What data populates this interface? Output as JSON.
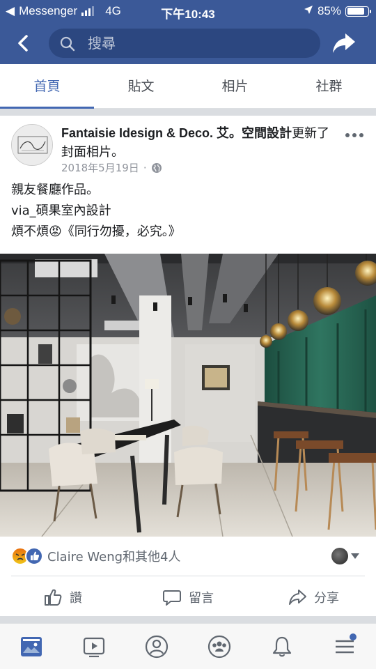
{
  "status_bar": {
    "carrier": "Messenger",
    "network": "4G",
    "time": "下午10:43",
    "battery_percent": "85%",
    "battery_level": 0.85
  },
  "top_nav": {
    "search_placeholder": "搜尋"
  },
  "tabs": [
    {
      "label": "首頁",
      "active": true
    },
    {
      "label": "貼文",
      "active": false
    },
    {
      "label": "相片",
      "active": false
    },
    {
      "label": "社群",
      "active": false
    }
  ],
  "post": {
    "author": "Fantaisie Idesign & Deco. 艾。空間設計",
    "action": "更新了封面相片。",
    "date": "2018年5月19日",
    "privacy_icon": "globe-icon",
    "caption": [
      "親友餐廳作品。",
      "via_碩果室內設計",
      "煩不煩😡《同行勿擾，必究。》"
    ],
    "reactions": {
      "icons": [
        "angry-reaction-icon",
        "like-reaction-icon"
      ],
      "text": "Claire Weng和其他4人"
    },
    "actions": [
      {
        "label": "讚",
        "icon": "thumbs-up-icon"
      },
      {
        "label": "留言",
        "icon": "comment-icon"
      },
      {
        "label": "分享",
        "icon": "share-icon"
      }
    ]
  },
  "bottom_nav": [
    {
      "icon": "news-feed-icon",
      "active": true
    },
    {
      "icon": "watch-icon",
      "active": false
    },
    {
      "icon": "profile-icon",
      "active": false
    },
    {
      "icon": "groups-icon",
      "active": false
    },
    {
      "icon": "notifications-icon",
      "active": false
    },
    {
      "icon": "menu-icon",
      "active": false
    }
  ],
  "colors": {
    "brand_blue": "#3b5998",
    "accent": "#4267b2",
    "secondary_text": "#90949c"
  }
}
